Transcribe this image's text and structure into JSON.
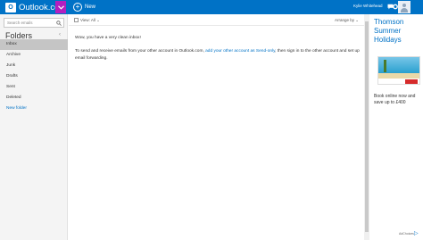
{
  "header": {
    "brand_icon_letter": "O",
    "brand_name": "Outlook.com",
    "new_label": "New",
    "user_name": "Kylie Whitehead",
    "icons": [
      "outlook-logo-icon",
      "chevron-down-icon",
      "plus-icon",
      "chat-icon",
      "gear-icon",
      "avatar"
    ],
    "accent_color": "#0072c6",
    "apps_button_color": "#b41fbf"
  },
  "sidebar": {
    "search_placeholder": "Search emails",
    "folders_title": "Folders",
    "collapse_glyph": "‹",
    "folders": [
      {
        "label": "Inbox",
        "selected": true
      },
      {
        "label": "Archive",
        "selected": false
      },
      {
        "label": "Junk",
        "selected": false
      },
      {
        "label": "Drafts",
        "selected": false
      },
      {
        "label": "Sent",
        "selected": false
      },
      {
        "label": "Deleted",
        "selected": false
      }
    ],
    "new_folder_label": "New folder"
  },
  "toolbar": {
    "view_label": "View: All ⌄",
    "arrange_label": "Arrange by ⌄"
  },
  "inbox": {
    "empty_message": "Wow, you have a very clean inbox!",
    "info_before": "To send and receive emails from your other account in Outlook.com, ",
    "info_link": "add your other account as Send-only",
    "info_after": ", then sign in to the other account and set up email forwarding."
  },
  "ad": {
    "title": "Thomson Summer Holidays",
    "body": "Book online now and save up to £400",
    "choices_label": "AdChoices"
  }
}
